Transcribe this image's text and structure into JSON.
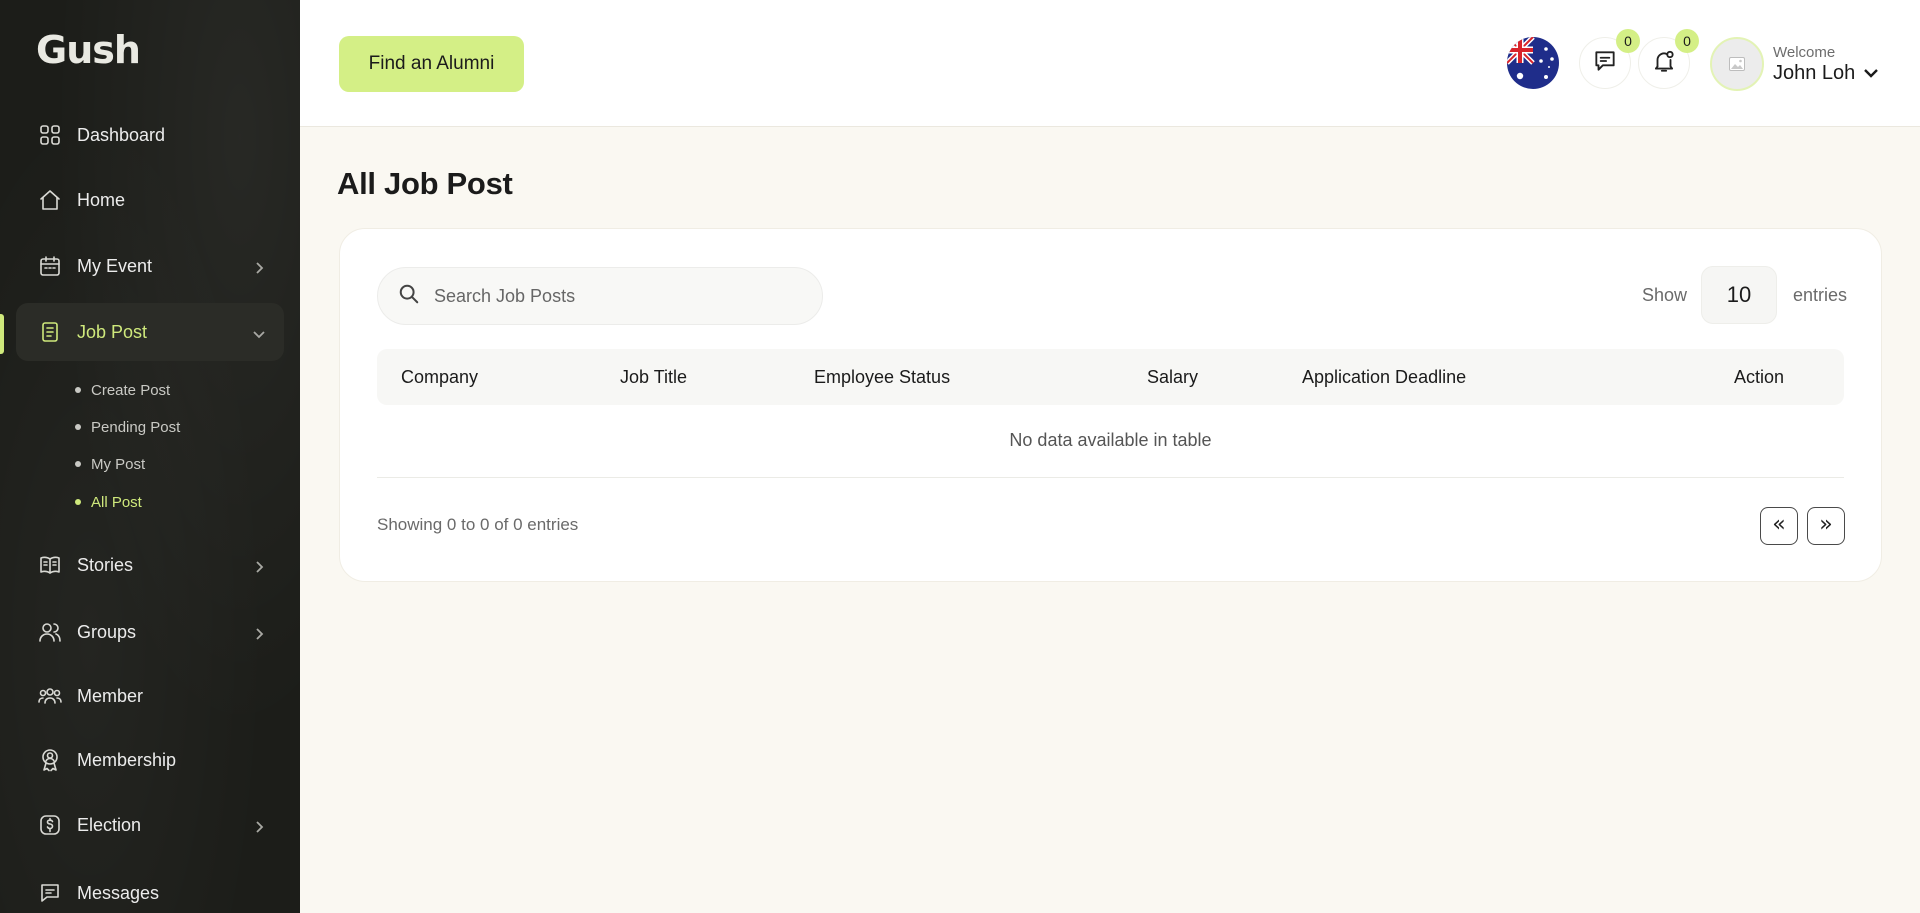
{
  "brand": {
    "logo_text": "Gush"
  },
  "sidebar": {
    "items": [
      {
        "label": "Dashboard",
        "icon": "dashboard-icon",
        "has_chevron": false
      },
      {
        "label": "Home",
        "icon": "home-icon",
        "has_chevron": false
      },
      {
        "label": "My Event",
        "icon": "calendar-icon",
        "has_chevron": true
      },
      {
        "label": "Job Post",
        "icon": "document-icon",
        "has_chevron": true,
        "active": true
      },
      {
        "label": "Stories",
        "icon": "book-icon",
        "has_chevron": true
      },
      {
        "label": "Groups",
        "icon": "users-icon",
        "has_chevron": true
      },
      {
        "label": "Member",
        "icon": "members-icon",
        "has_chevron": false
      },
      {
        "label": "Membership",
        "icon": "badge-icon",
        "has_chevron": false
      },
      {
        "label": "Election",
        "icon": "dollar-icon",
        "has_chevron": true
      },
      {
        "label": "Messages",
        "icon": "message-icon",
        "has_chevron": false
      }
    ],
    "job_post_submenu": [
      {
        "label": "Create Post"
      },
      {
        "label": "Pending Post"
      },
      {
        "label": "My Post"
      },
      {
        "label": "All Post",
        "current": true
      }
    ],
    "accent_color": "#cfe97c"
  },
  "header": {
    "find_button": "Find an Alumni",
    "messages_count": "0",
    "notifications_count": "0",
    "welcome": "Welcome",
    "user_name": "John Loh",
    "flag": "australia-flag-icon"
  },
  "main": {
    "title": "All Job Post",
    "search_placeholder": "Search Job Posts",
    "show_label": "Show",
    "page_size": "10",
    "entries_label": "entries",
    "table": {
      "columns": [
        "Company",
        "Job Title",
        "Employee Status",
        "Salary",
        "Application Deadline",
        "Action"
      ],
      "empty_message": "No data available in table"
    },
    "info": "Showing 0 to 0 of 0 entries",
    "pagination": {
      "prev": "«",
      "next": "»"
    }
  }
}
